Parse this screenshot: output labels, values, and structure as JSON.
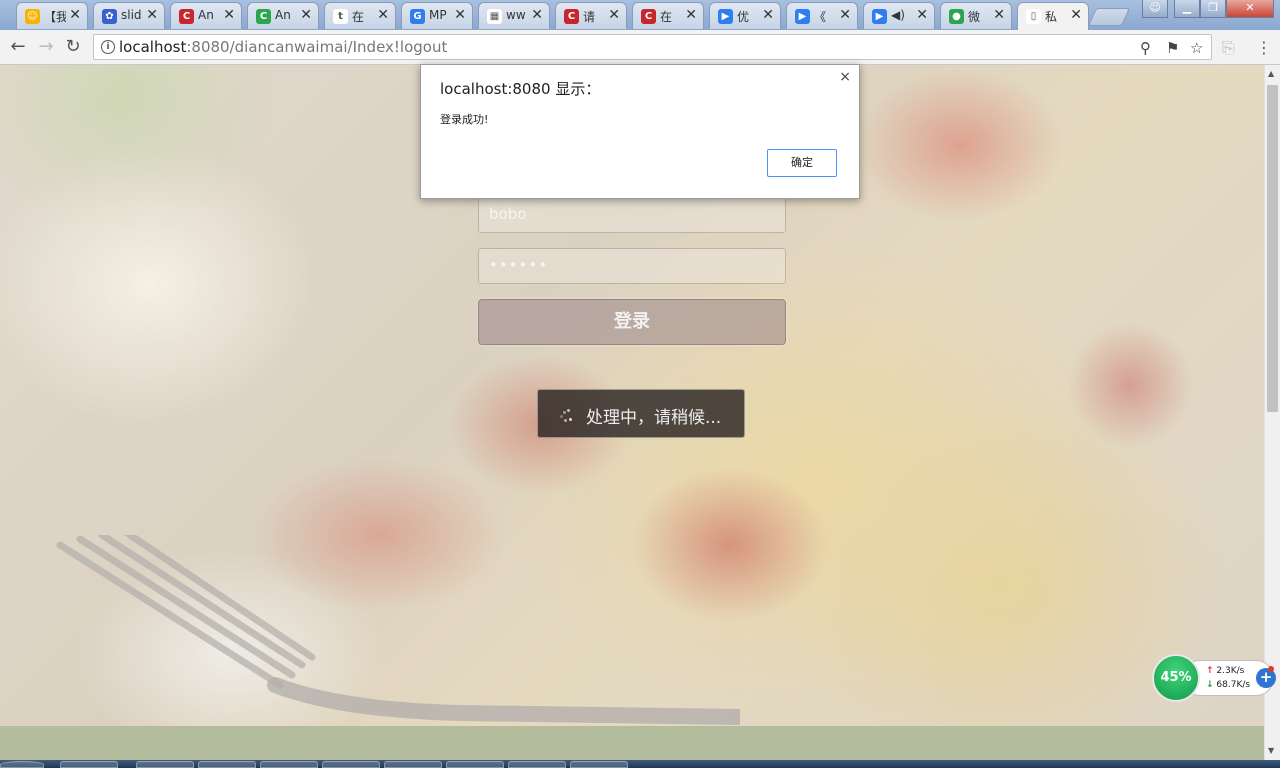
{
  "browser": {
    "tabs": [
      {
        "title": "【我",
        "fav_color": "#f5b400",
        "fav_char": "☺",
        "active": false
      },
      {
        "title": "slid",
        "fav_color": "#3a5fd0",
        "fav_char": "✿",
        "active": false
      },
      {
        "title": "An",
        "fav_color": "#c9252c",
        "fav_char": "C",
        "active": false
      },
      {
        "title": "An",
        "fav_color": "#2da44e",
        "fav_char": "C",
        "active": false
      },
      {
        "title": "在",
        "fav_color": "#ffffff",
        "fav_char": "t",
        "active": false
      },
      {
        "title": "MP",
        "fav_color": "#2e7ef0",
        "fav_char": "G",
        "active": false
      },
      {
        "title": "ww",
        "fav_color": "#ffffff",
        "fav_char": "▦",
        "active": false
      },
      {
        "title": "请",
        "fav_color": "#c9252c",
        "fav_char": "C",
        "active": false
      },
      {
        "title": "在",
        "fav_color": "#c9252c",
        "fav_char": "C",
        "active": false
      },
      {
        "title": "优",
        "fav_color": "#2e7ef0",
        "fav_char": "▶",
        "active": false
      },
      {
        "title": "《",
        "fav_color": "#2e7ef0",
        "fav_char": "▶",
        "active": false
      },
      {
        "title": "◀)",
        "fav_color": "#2e7ef0",
        "fav_char": "▶",
        "active": false
      },
      {
        "title": "微",
        "fav_color": "#2da44e",
        "fav_char": "●",
        "active": false
      },
      {
        "title": "私",
        "fav_color": "#ffffff",
        "fav_char": "▯",
        "active": true
      }
    ],
    "close_glyph": "✕",
    "url_host": "localhost",
    "url_rest": ":8080/diancanwaimai/Index!logout"
  },
  "page": {
    "username_value": "bobo",
    "password_value": "••••••",
    "login_label": "登录",
    "loading_text": "处理中，请稍候..."
  },
  "dialog": {
    "title": "localhost:8080 显示：",
    "message": "登录成功!",
    "ok_label": "确定",
    "close_glyph": "×"
  },
  "network_widget": {
    "percent": "45%",
    "upload": "2.3K/s",
    "download": "68.7K/s"
  }
}
